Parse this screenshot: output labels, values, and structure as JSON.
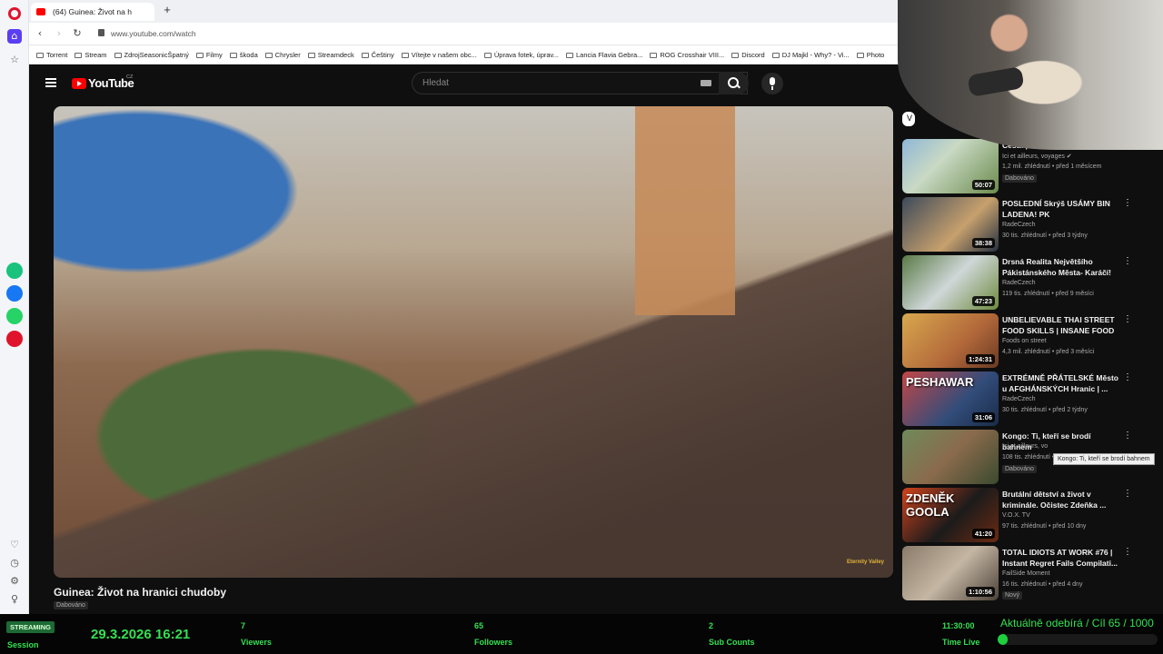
{
  "browser": {
    "tab_title": "(64) Guinea: Život na h",
    "url": "www.youtube.com/watch",
    "bookmarks": [
      "Torrent",
      "Stream",
      "ZdrojSeasonicŠpatný",
      "Filmy",
      "škoda",
      "Chrysler",
      "Streamdeck",
      "Češtiny",
      "Vítejte v našem obc...",
      "Úprava fotek, úprav...",
      "Lancia Flavia Gebra...",
      "ROG Crosshair VIII...",
      "Discord",
      "DJ Majkl - Why? - Vi...",
      "Photo"
    ]
  },
  "youtube": {
    "logo_text": "YouTube",
    "region": "CZ",
    "search_placeholder": "Hledat",
    "video": {
      "title": "Guinea: Život na hranici chudoby",
      "badge": "Dabováno",
      "watermark": "Eternity Valley"
    },
    "chip_label": "V",
    "tooltip": "Kongo: Ti, kteří se brodí bahnem",
    "recommended": [
      {
        "title": "Cesta po Laosu",
        "channel": "Ici et ailleurs, voyages ✔",
        "meta": "1,2 mil. zhlédnutí • před 1 měsícem",
        "badge": "Dabováno",
        "duration": "50:07",
        "thumb_text": ""
      },
      {
        "title": "POSLEDNÍ Skrýš USÁMY BIN LADENA! PK",
        "channel": "RadeCzech",
        "meta": "30 tis. zhlédnutí • před 3 týdny",
        "badge": "",
        "duration": "38:38",
        "thumb_text": ""
      },
      {
        "title": "Drsná Realita Největšího Pákistánského Města- Karáčí! ...",
        "channel": "RadeCzech",
        "meta": "119 tis. zhlédnutí • před 9 měsíci",
        "badge": "",
        "duration": "47:23",
        "thumb_text": ""
      },
      {
        "title": "UNBELIEVABLE THAI STREET FOOD SKILLS | INSANE FOOD ...",
        "channel": "Foods on street",
        "meta": "4,3 mil. zhlédnutí • před 3 měsíci",
        "badge": "",
        "duration": "1:24:31",
        "thumb_text": ""
      },
      {
        "title": "EXTRÉMNĚ PŘÁTELSKÉ Město u AFGHÁNSKÝCH Hranic | ...",
        "channel": "RadeCzech",
        "meta": "30 tis. zhlédnutí • před 2 týdny",
        "badge": "",
        "duration": "31:06",
        "thumb_text": "PESHAWAR"
      },
      {
        "title": "Kongo: Ti, kteří se brodí bahnem",
        "channel": "Ici et ailleurs, vo",
        "meta": "108 tis. zhlédnutí • před 7 dny",
        "badge": "Dabováno",
        "duration": "",
        "thumb_text": ""
      },
      {
        "title": "Brutální dětství a život v kriminále. Očistec Zdeňka ...",
        "channel": "V.O.X. TV",
        "meta": "97 tis. zhlédnutí • před 10 dny",
        "badge": "",
        "duration": "41:20",
        "thumb_text": "ZDENĚK GOOLA"
      },
      {
        "title": "TOTAL IDIOTS AT WORK #76 | Instant Regret Fails Compilati...",
        "channel": "FailSide Moment",
        "meta": "16 tis. zhlédnutí • před 4 dny",
        "badge": "Nový",
        "duration": "1:10:56",
        "thumb_text": ""
      }
    ]
  },
  "stream": {
    "badge": "STREAMING",
    "session_label": "Session",
    "datetime": "29.3.2026 16:21",
    "viewers": {
      "value": "7",
      "label": "Viewers"
    },
    "followers": {
      "value": "65",
      "label": "Followers"
    },
    "subs": {
      "value": "2",
      "label": "Sub Counts"
    },
    "live": {
      "value": "11:30:00",
      "label": "Time Live"
    },
    "goal_text": "Aktuálně odebírá / Cíl  65 / 1000",
    "goal_progress": 0.065
  },
  "colors": {
    "accent_green": "#34e052",
    "yt_red": "#ff0000",
    "opera_red": "#e0132c"
  }
}
